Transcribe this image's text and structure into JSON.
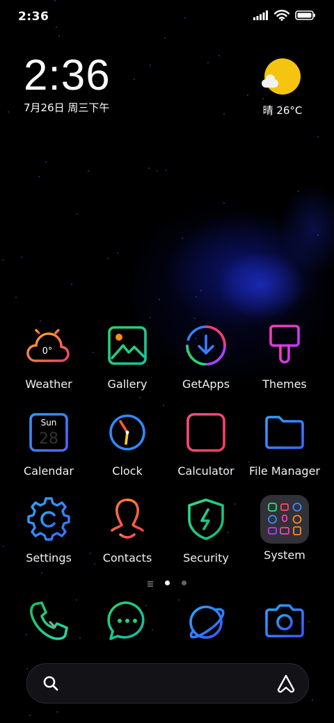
{
  "status_bar": {
    "time": "2:36"
  },
  "clock_widget": {
    "time": "2:36",
    "date": "7月26日 周三下午"
  },
  "weather_widget": {
    "text": "晴 26°C"
  },
  "apps": [
    {
      "label": "Weather",
      "icon": "weather-icon",
      "badge": "0°"
    },
    {
      "label": "Gallery",
      "icon": "gallery-icon"
    },
    {
      "label": "GetApps",
      "icon": "getapps-icon"
    },
    {
      "label": "Themes",
      "icon": "themes-icon"
    },
    {
      "label": "Calendar",
      "icon": "calendar-icon",
      "day_name": "Sun",
      "day_number": "28"
    },
    {
      "label": "Clock",
      "icon": "clock-icon"
    },
    {
      "label": "Calculator",
      "icon": "calculator-icon"
    },
    {
      "label": "File Manager",
      "icon": "folder-icon"
    },
    {
      "label": "Settings",
      "icon": "gear-icon"
    },
    {
      "label": "Contacts",
      "icon": "contacts-icon"
    },
    {
      "label": "Security",
      "icon": "shield-icon"
    },
    {
      "label": "System",
      "icon": "folder-system-icon"
    }
  ],
  "page_indicator": {
    "pages": 2,
    "current": 1
  },
  "dock": [
    {
      "name": "phone",
      "icon": "phone-icon"
    },
    {
      "name": "messages",
      "icon": "message-icon"
    },
    {
      "name": "browser",
      "icon": "browser-icon"
    },
    {
      "name": "camera",
      "icon": "camera-icon"
    }
  ],
  "search": {
    "icon": "search-icon",
    "assistant_icon": "assistant-icon"
  }
}
